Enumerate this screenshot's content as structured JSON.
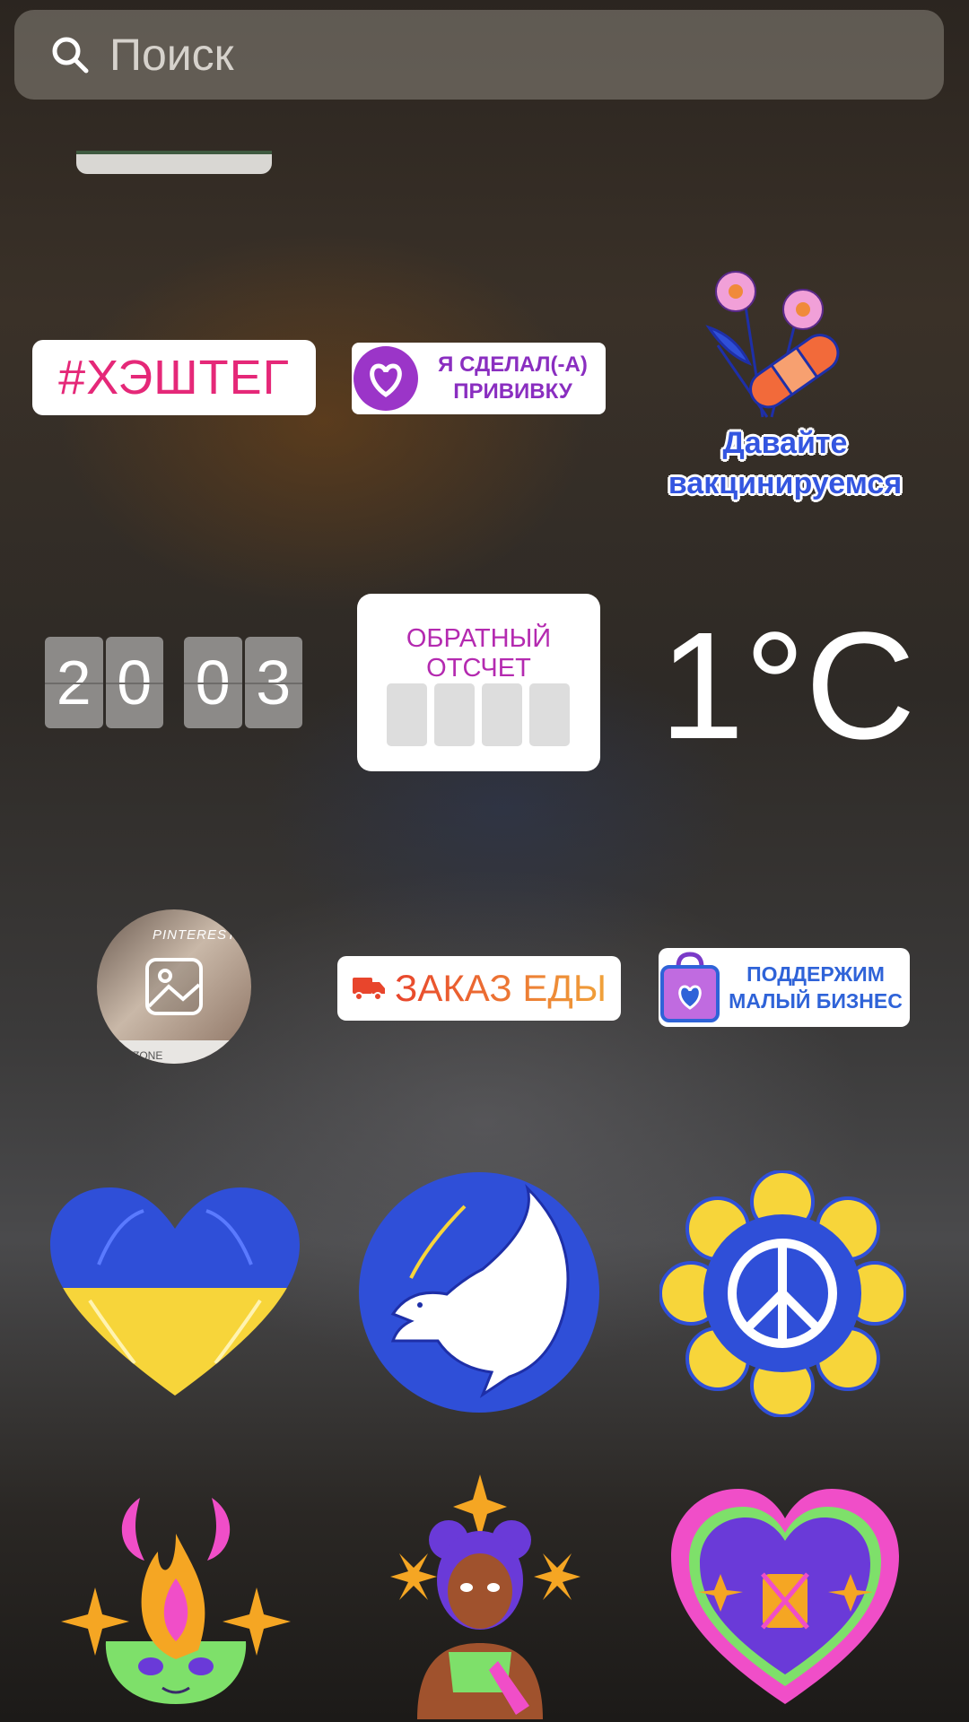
{
  "search": {
    "placeholder": "Поиск"
  },
  "stickers": {
    "hashtag": "#ХЭШТЕГ",
    "vaccinated": "Я СДЕЛАЛ(-А) ПРИВИВКУ",
    "lets_vaccinate": {
      "line1": "Давайте",
      "line2": "вакцинируемся"
    },
    "counter_digits": [
      "2",
      "0",
      "0",
      "3"
    ],
    "countdown_title": "ОБРАТНЫЙ ОТСЧЕТ",
    "temperature": "1°C",
    "photo": {
      "label1": "PINTEREST",
      "label2": "ZONE"
    },
    "food_order": "ЗАКАЗ ЕДЫ",
    "small_business": "ПОДДЕРЖИМ МАЛЫЙ БИЗНЕС"
  },
  "colors": {
    "hashtag": "#e52878",
    "countdown": "#b42ab0",
    "ukraine_blue": "#2f4fd8",
    "ukraine_yellow": "#f7d53a"
  },
  "icons": [
    "search-icon",
    "heart-ukraine-icon",
    "dove-icon",
    "peace-flower-icon",
    "flame-face-icon",
    "woman-icon",
    "heart-lantern-icon"
  ]
}
